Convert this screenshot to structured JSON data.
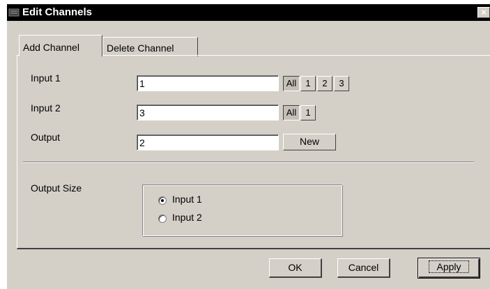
{
  "window": {
    "title": "Edit Channels",
    "close_label": "×"
  },
  "tabs": [
    {
      "label": "Add Channel",
      "active": true
    },
    {
      "label": "Delete Channel",
      "active": false
    }
  ],
  "form": {
    "input1": {
      "label": "Input 1",
      "value": "1",
      "buttons": [
        "All",
        "1",
        "2",
        "3"
      ]
    },
    "input2": {
      "label": "Input 2",
      "value": "3",
      "buttons": [
        "All",
        "1"
      ]
    },
    "output": {
      "label": "Output",
      "value": "2",
      "new_label": "New"
    },
    "output_size": {
      "label": "Output Size",
      "options": [
        {
          "label": "Input 1",
          "checked": true
        },
        {
          "label": "Input 2",
          "checked": false
        }
      ]
    }
  },
  "footer": {
    "ok_label": "OK",
    "cancel_label": "Cancel",
    "apply_label": "Apply"
  }
}
